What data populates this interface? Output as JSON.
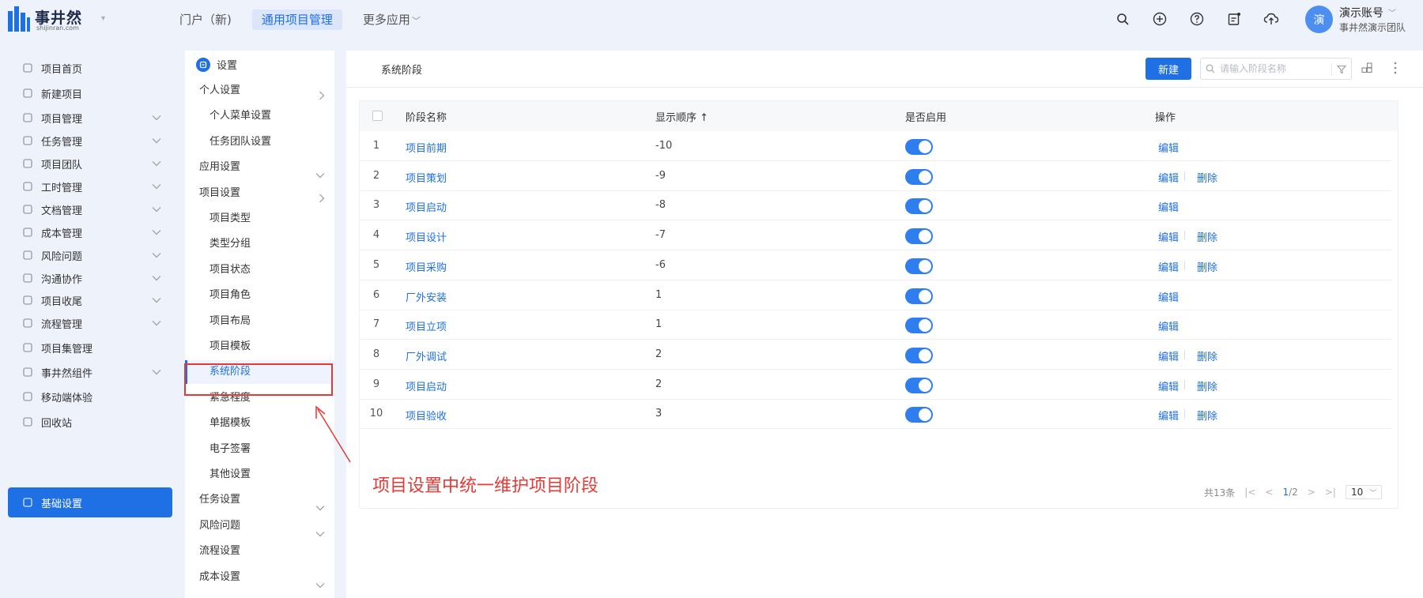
{
  "app": {
    "logo_text": "事井然",
    "logo_sub": "shijinran.com"
  },
  "topnav": [
    {
      "label": "门户（新)",
      "active": false,
      "caret": false
    },
    {
      "label": "通用项目管理",
      "active": true,
      "caret": false
    },
    {
      "label": "更多应用",
      "active": false,
      "caret": true
    }
  ],
  "top_icons": [
    "search-icon",
    "plus-circle-icon",
    "help-icon",
    "notice-icon",
    "cloud-upload-icon"
  ],
  "user": {
    "avatar": "演",
    "name": "演示账号",
    "team": "事井然演示团队"
  },
  "sidebar": {
    "items": [
      {
        "label": "项目首页",
        "icon": "home-icon",
        "chevron": false,
        "active": false
      },
      {
        "label": "新建项目",
        "icon": "file-plus-icon",
        "chevron": false,
        "active": false
      },
      {
        "label": "项目管理",
        "icon": "project-icon",
        "chevron": true,
        "active": false
      },
      {
        "label": "任务管理",
        "icon": "list-icon",
        "chevron": true,
        "active": false
      },
      {
        "label": "项目团队",
        "icon": "team-icon",
        "chevron": true,
        "active": false
      },
      {
        "label": "工时管理",
        "icon": "clock-icon",
        "chevron": true,
        "active": false
      },
      {
        "label": "文档管理",
        "icon": "doc-icon",
        "chevron": true,
        "active": false
      },
      {
        "label": "成本管理",
        "icon": "wallet-icon",
        "chevron": true,
        "active": false
      },
      {
        "label": "风险问题",
        "icon": "shield-icon",
        "chevron": true,
        "active": false
      },
      {
        "label": "沟通协作",
        "icon": "handshake-icon",
        "chevron": true,
        "active": false
      },
      {
        "label": "项目收尾",
        "icon": "archive-icon",
        "chevron": true,
        "active": false
      },
      {
        "label": "流程管理",
        "icon": "layers-icon",
        "chevron": true,
        "active": false
      },
      {
        "label": "项目集管理",
        "icon": "stack-icon",
        "chevron": false,
        "active": false
      },
      {
        "label": "事井然组件",
        "icon": "at-icon",
        "chevron": true,
        "active": false
      },
      {
        "label": "移动端体验",
        "icon": "mobile-icon",
        "chevron": false,
        "active": false
      },
      {
        "label": "回收站",
        "icon": "trash-icon",
        "chevron": false,
        "active": false
      },
      {
        "label": "基础设置",
        "icon": "gear-icon",
        "chevron": false,
        "active": true
      }
    ]
  },
  "settings_menu": {
    "title": "设置",
    "items": [
      {
        "label": "个人设置",
        "level": 1,
        "chevron": "right"
      },
      {
        "label": "个人菜单设置",
        "level": 2
      },
      {
        "label": "任务团队设置",
        "level": 2
      },
      {
        "label": "应用设置",
        "level": 1,
        "chevron": "down"
      },
      {
        "label": "项目设置",
        "level": 1,
        "chevron": "right"
      },
      {
        "label": "项目类型",
        "level": 2
      },
      {
        "label": "类型分组",
        "level": 2
      },
      {
        "label": "项目状态",
        "level": 2
      },
      {
        "label": "项目角色",
        "level": 2
      },
      {
        "label": "项目布局",
        "level": 2
      },
      {
        "label": "项目模板",
        "level": 2
      },
      {
        "label": "系统阶段",
        "level": 2,
        "selected": true
      },
      {
        "label": "紧急程度",
        "level": 2
      },
      {
        "label": "单据模板",
        "level": 2
      },
      {
        "label": "电子签署",
        "level": 2
      },
      {
        "label": "其他设置",
        "level": 2
      },
      {
        "label": "任务设置",
        "level": 1,
        "chevron": "down"
      },
      {
        "label": "风险问题",
        "level": 1,
        "chevron": "down"
      },
      {
        "label": "流程设置",
        "level": 1
      },
      {
        "label": "成本设置",
        "level": 1,
        "chevron": "down"
      }
    ]
  },
  "main": {
    "title": "系统阶段",
    "new_button": "新建",
    "search_placeholder": "请输入阶段名称",
    "columns": {
      "name": "阶段名称",
      "order": "显示顺序 ↑",
      "enabled": "是否启用",
      "ops": "操作"
    },
    "rows": [
      {
        "idx": "1",
        "name": "项目前期",
        "order": "-10",
        "enabled": true,
        "deletable": false
      },
      {
        "idx": "2",
        "name": "项目策划",
        "order": "-9",
        "enabled": true,
        "deletable": true
      },
      {
        "idx": "3",
        "name": "项目启动",
        "order": "-8",
        "enabled": true,
        "deletable": false
      },
      {
        "idx": "4",
        "name": "项目设计",
        "order": "-7",
        "enabled": true,
        "deletable": true
      },
      {
        "idx": "5",
        "name": "项目采购",
        "order": "-6",
        "enabled": true,
        "deletable": true
      },
      {
        "idx": "6",
        "name": "厂外安装",
        "order": "1",
        "enabled": true,
        "deletable": false
      },
      {
        "idx": "7",
        "name": "项目立项",
        "order": "1",
        "enabled": true,
        "deletable": false
      },
      {
        "idx": "8",
        "name": "厂外调试",
        "order": "2",
        "enabled": true,
        "deletable": true
      },
      {
        "idx": "9",
        "name": "项目启动",
        "order": "2",
        "enabled": true,
        "deletable": true
      },
      {
        "idx": "10",
        "name": "项目验收",
        "order": "3",
        "enabled": true,
        "deletable": true
      }
    ],
    "edit_label": "编辑",
    "delete_label": "删除",
    "pager": {
      "total": "共13条",
      "current": "1",
      "pages": "/2",
      "page_size": "10"
    }
  },
  "annotation": {
    "text": "项目设置中统一维护项目阶段",
    "color": "#e53935"
  },
  "colors": {
    "accent": "#1f6fe5",
    "annotation": "#e53935"
  }
}
